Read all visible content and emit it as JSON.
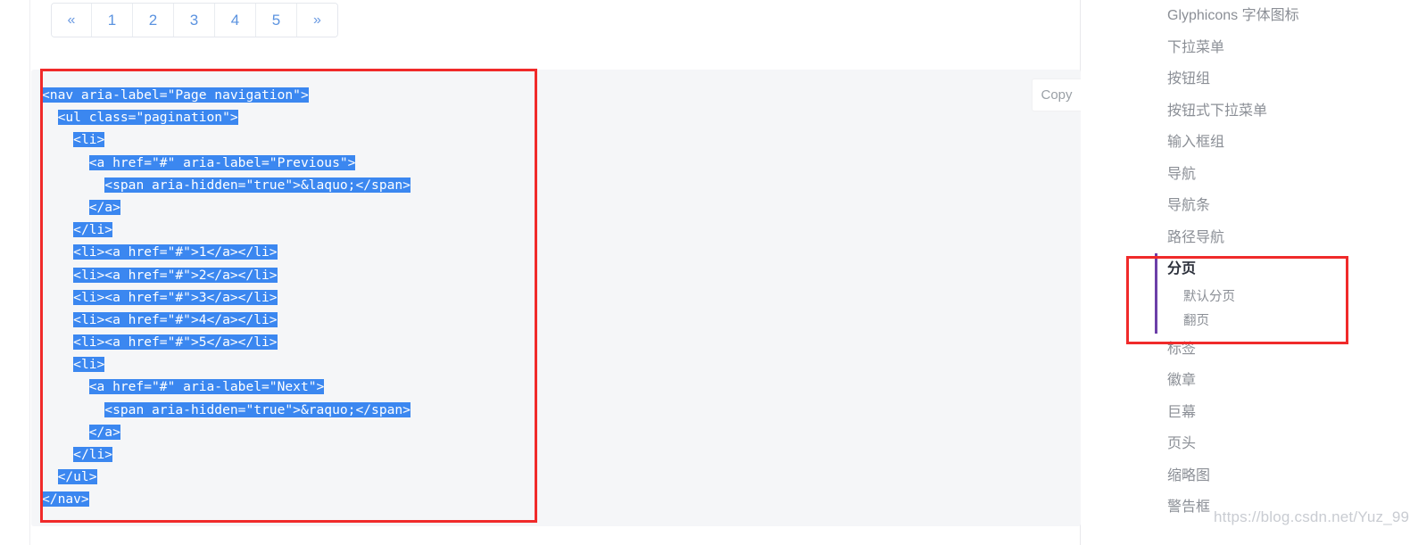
{
  "pagination_demo": {
    "items": [
      {
        "label": "«",
        "name": "pagination-prev"
      },
      {
        "label": "1",
        "name": "pagination-page-1"
      },
      {
        "label": "2",
        "name": "pagination-page-2"
      },
      {
        "label": "3",
        "name": "pagination-page-3"
      },
      {
        "label": "4",
        "name": "pagination-page-4"
      },
      {
        "label": "5",
        "name": "pagination-page-5"
      },
      {
        "label": "»",
        "name": "pagination-next"
      }
    ]
  },
  "code_block": {
    "copy_label": "Copy",
    "language": "html",
    "selection_color": "#3b87f0",
    "background": "#f5f6f8",
    "lines": [
      {
        "indent": 0,
        "text": "<nav aria-label=\"Page navigation\">",
        "selected": true
      },
      {
        "indent": 2,
        "text": "<ul class=\"pagination\">",
        "selected": true
      },
      {
        "indent": 4,
        "text": "<li>",
        "selected": true
      },
      {
        "indent": 6,
        "text": "<a href=\"#\" aria-label=\"Previous\">",
        "selected": true
      },
      {
        "indent": 8,
        "text": "<span aria-hidden=\"true\">&laquo;</span>",
        "selected": true
      },
      {
        "indent": 6,
        "text": "</a>",
        "selected": true
      },
      {
        "indent": 4,
        "text": "</li>",
        "selected": true
      },
      {
        "indent": 4,
        "text": "<li><a href=\"#\">1</a></li>",
        "selected": true
      },
      {
        "indent": 4,
        "text": "<li><a href=\"#\">2</a></li>",
        "selected": true
      },
      {
        "indent": 4,
        "text": "<li><a href=\"#\">3</a></li>",
        "selected": true
      },
      {
        "indent": 4,
        "text": "<li><a href=\"#\">4</a></li>",
        "selected": true
      },
      {
        "indent": 4,
        "text": "<li><a href=\"#\">5</a></li>",
        "selected": true
      },
      {
        "indent": 4,
        "text": "<li>",
        "selected": true
      },
      {
        "indent": 6,
        "text": "<a href=\"#\" aria-label=\"Next\">",
        "selected": true
      },
      {
        "indent": 8,
        "text": "<span aria-hidden=\"true\">&raquo;</span>",
        "selected": true
      },
      {
        "indent": 6,
        "text": "</a>",
        "selected": true
      },
      {
        "indent": 4,
        "text": "</li>",
        "selected": true
      },
      {
        "indent": 2,
        "text": "</ul>",
        "selected": true
      },
      {
        "indent": 0,
        "text": "</nav>",
        "selected": true
      }
    ]
  },
  "sidebar": {
    "items": [
      {
        "label": "Glyphicons 字体图标",
        "name": "sidebar-item-glyphicons"
      },
      {
        "label": "下拉菜单",
        "name": "sidebar-item-dropdown"
      },
      {
        "label": "按钮组",
        "name": "sidebar-item-button-group"
      },
      {
        "label": "按钮式下拉菜单",
        "name": "sidebar-item-button-dropdown"
      },
      {
        "label": "输入框组",
        "name": "sidebar-item-input-group"
      },
      {
        "label": "导航",
        "name": "sidebar-item-nav"
      },
      {
        "label": "导航条",
        "name": "sidebar-item-navbar"
      },
      {
        "label": "路径导航",
        "name": "sidebar-item-breadcrumb"
      }
    ],
    "active_group": {
      "label": "分页",
      "name": "sidebar-item-pagination",
      "accent_color": "#6c3fa8",
      "children": [
        {
          "label": "默认分页",
          "name": "sidebar-subitem-default-pagination"
        },
        {
          "label": "翻页",
          "name": "sidebar-subitem-pager"
        }
      ]
    },
    "items_after": [
      {
        "label": "标签",
        "name": "sidebar-item-label"
      },
      {
        "label": "徽章",
        "name": "sidebar-item-badge"
      },
      {
        "label": "巨幕",
        "name": "sidebar-item-jumbotron"
      },
      {
        "label": "页头",
        "name": "sidebar-item-page-header"
      },
      {
        "label": "缩略图",
        "name": "sidebar-item-thumbnail"
      },
      {
        "label": "警告框",
        "name": "sidebar-item-alert"
      }
    ]
  },
  "annotations": {
    "highlight_color": "#f02a2a",
    "boxes": [
      {
        "name": "code-highlight-box"
      },
      {
        "name": "sidebar-highlight-box"
      }
    ]
  },
  "watermark": {
    "text": "https://blog.csdn.net/Yuz_99"
  }
}
